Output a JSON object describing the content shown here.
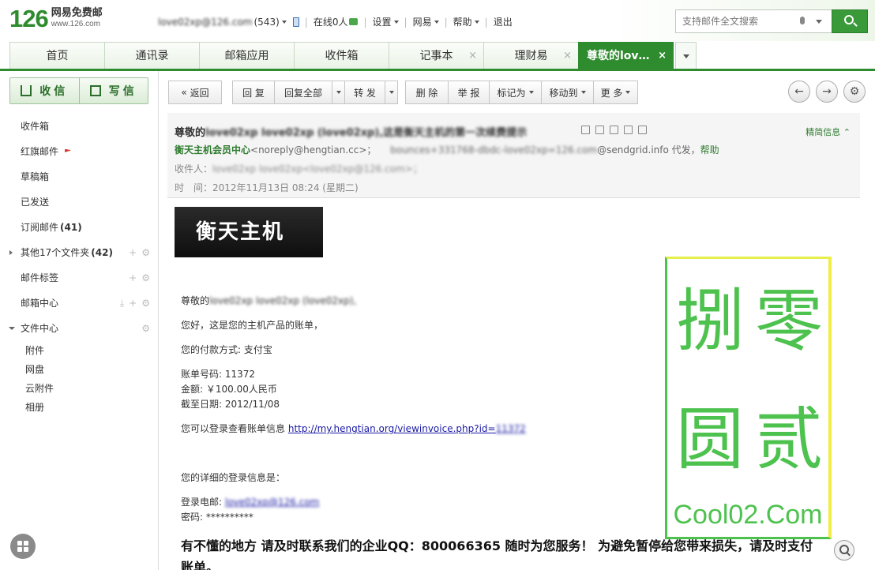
{
  "header": {
    "logo_number": "126",
    "logo_text": "网易免费邮",
    "logo_url": "www.126.com",
    "account": "love02xp@126.com",
    "unread_count": "(543)",
    "online": "在线0人",
    "settings": "设置",
    "netease": "网易",
    "help": "帮助",
    "logout": "退出",
    "search_placeholder": "支持邮件全文搜索"
  },
  "tabs": [
    {
      "label": "首页"
    },
    {
      "label": "通讯录"
    },
    {
      "label": "邮箱应用"
    },
    {
      "label": "收件箱"
    },
    {
      "label": "记事本",
      "close": "×"
    },
    {
      "label": "理财易",
      "close": "×"
    },
    {
      "label": "尊敬的lov…",
      "close": "×"
    }
  ],
  "sidebar": {
    "receive": "收信",
    "write": "写信",
    "items": [
      {
        "label": "收件箱"
      },
      {
        "label": "红旗邮件"
      },
      {
        "label": "草稿箱"
      },
      {
        "label": "已发送"
      },
      {
        "label": "订阅邮件",
        "count": "(41)"
      },
      {
        "label": "其他17个文件夹",
        "count": "(42)"
      },
      {
        "label": "邮件标签"
      },
      {
        "label": "邮箱中心"
      },
      {
        "label": "文件中心"
      }
    ],
    "sub_items": [
      "附件",
      "网盘",
      "云附件",
      "相册"
    ]
  },
  "toolbar": {
    "back": "返回",
    "reply": "回 复",
    "reply_all": "回复全部",
    "forward": "转 发",
    "delete": "删 除",
    "report": "举 报",
    "mark_as": "标记为",
    "move_to": "移动到",
    "more": "更 多"
  },
  "message": {
    "subject_prefix": "尊敬的",
    "subject_blurred": "love02xp love02xp (love02xp),这是衡天主机的第一次续费提示",
    "brief_info": "精简信息",
    "from_name": "衡天主机会员中心",
    "from_addr": "<noreply@hengtian.cc>；",
    "via_blurred": "bounces+331768-dbdc-love02xp=126.com",
    "via_domain": "@sendgrid.info 代发，",
    "help": "帮助",
    "to_label": "收件人：",
    "to_blurred": "love02xp love02xp<love02xp@126.com>；",
    "time_label": "时　间：",
    "time_value": "2012年11月13日 08:24 (星期二)"
  },
  "body": {
    "logo_text": "衡天主机",
    "greeting_prefix": "尊敬的",
    "greeting_blurred": "love02xp love02xp (love02xp),",
    "line_hello": "您好，这是您的主机产品的账单，",
    "line_pay": "您的付款方式: 支付宝",
    "line_bill_no": "账单号码: 11372",
    "line_amount": "金额: ￥100.00人民币",
    "line_due": "截至日期: 2012/11/08",
    "line_view_prefix": "您可以登录查看账单信息",
    "link_url": "http://my.hengtian.org/viewinvoice.php?id=",
    "link_id": "11372",
    "line_login_info": "您的详细的登录信息是：",
    "line_email_prefix": "登录电邮:",
    "line_email_blurred": "love02xp@126.com",
    "line_password": "密码: **********",
    "line_big": "有不懂的地方 请及时联系我们的企业QQ：800066365 随时为您服务！ 为避免暂停给您带来损失，请及时支付",
    "line_big2": "账单。"
  },
  "watermark": {
    "chars": [
      "零",
      "捌",
      "贰",
      "圆"
    ],
    "text": "Cool02.Com"
  },
  "colors": {
    "brand_green": "#2e8b2e",
    "link_green": "#2e7b2e",
    "flag_red": "#d9362b"
  }
}
